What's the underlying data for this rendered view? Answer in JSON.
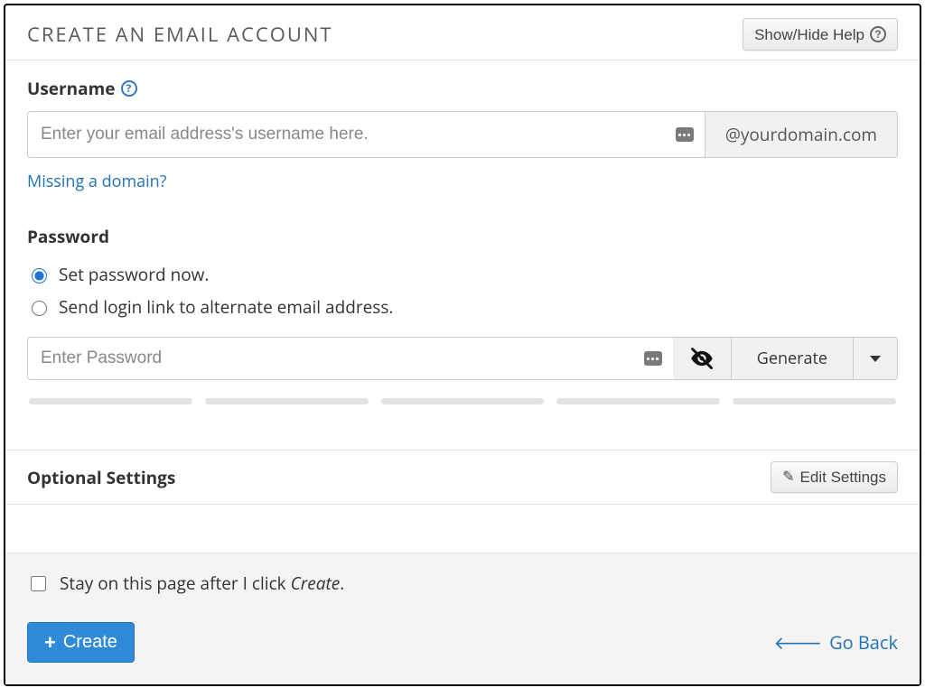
{
  "header": {
    "title": "Create an Email Account",
    "help_toggle": "Show/Hide Help"
  },
  "username": {
    "label": "Username",
    "placeholder": "Enter your email address's username here.",
    "domain_addon": "@yourdomain.com",
    "missing_link": "Missing a domain?"
  },
  "password": {
    "label": "Password",
    "option_set_now": "Set password now.",
    "option_send_link": "Send login link to alternate email address.",
    "placeholder": "Enter Password",
    "generate_label": "Generate"
  },
  "optional": {
    "title": "Optional Settings",
    "edit_label": "Edit Settings"
  },
  "footer": {
    "stay_prefix": "Stay on this page after I click ",
    "stay_word": "Create",
    "stay_suffix": ".",
    "create_label": "Create",
    "go_back_label": "Go Back"
  }
}
